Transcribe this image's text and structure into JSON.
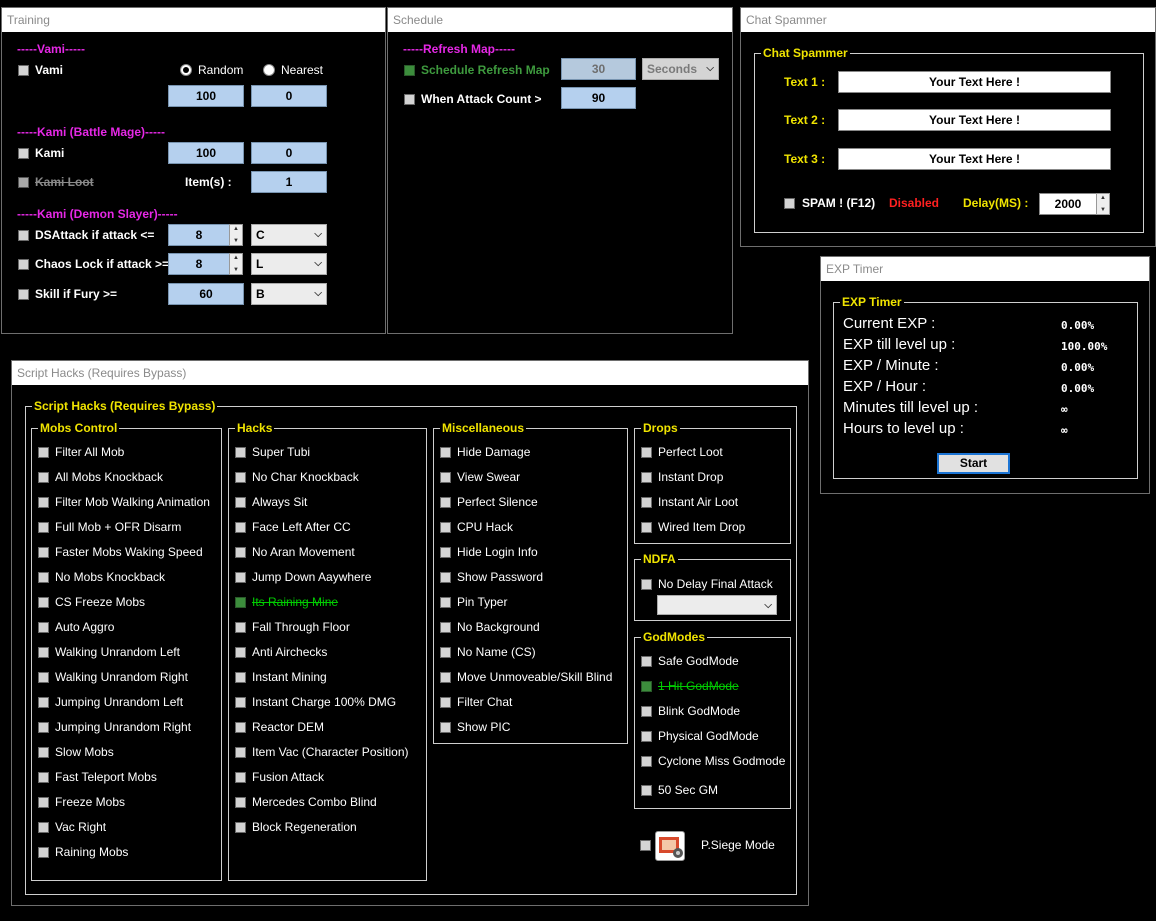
{
  "training": {
    "title": "Training",
    "vami_header": "-----Vami-----",
    "vami_label": "Vami",
    "radio_random": "Random",
    "radio_nearest": "Nearest",
    "vami_val1": "100",
    "vami_val2": "0",
    "kami_bm_header": "-----Kami (Battle Mage)-----",
    "kami_label": "Kami",
    "kami_val1": "100",
    "kami_val2": "0",
    "kami_loot_label": "Kami Loot",
    "items_label": "Item(s) :",
    "items_val": "1",
    "kami_ds_header": "-----Kami (Demon Slayer)-----",
    "ds_attack_label": "DSAttack if attack <=",
    "ds_attack_val": "8",
    "ds_attack_key": "C",
    "chaos_label": "Chaos Lock if attack >=",
    "chaos_val": "8",
    "chaos_key": "L",
    "skill_label": "Skill if Fury >=",
    "skill_val": "60",
    "skill_key": "B"
  },
  "schedule": {
    "title": "Schedule",
    "header": "-----Refresh Map-----",
    "refresh_label": "Schedule Refresh Map",
    "refresh_val": "30",
    "refresh_unit": "Seconds",
    "attack_label": "When Attack Count >",
    "attack_val": "90"
  },
  "chat": {
    "title": "Chat Spammer",
    "group_title": "Chat Spammer",
    "text1_label": "Text 1 :",
    "text1": "Your Text Here !",
    "text2_label": "Text 2 :",
    "text2": "Your Text Here !",
    "text3_label": "Text 3 :",
    "text3": "Your Text Here !",
    "spam_label": "SPAM ! (F12)",
    "status": "Disabled",
    "delay_label": "Delay(MS) :",
    "delay_val": "2000"
  },
  "exp": {
    "title": "EXP Timer",
    "group_title": "EXP Timer",
    "rows": [
      {
        "label": "Current EXP :",
        "value": "0.00%"
      },
      {
        "label": "EXP till level up :",
        "value": "100.00%"
      },
      {
        "label": "EXP / Minute :",
        "value": "0.00%"
      },
      {
        "label": "EXP / Hour :",
        "value": "0.00%"
      },
      {
        "label": "Minutes till level up :",
        "value": "∞"
      },
      {
        "label": "Hours to level up :",
        "value": "∞"
      }
    ],
    "start_button": "Start"
  },
  "script": {
    "title": "Script Hacks (Requires Bypass)",
    "group_title": "Script Hacks (Requires Bypass)",
    "mobs_title": "Mobs Control",
    "mobs": [
      "Filter All Mob",
      "All Mobs Knockback",
      "Filter Mob Walking Animation",
      "Full Mob + OFR Disarm",
      "Faster Mobs Waking Speed",
      "No Mobs Knockback",
      "CS Freeze Mobs",
      "Auto Aggro",
      "Walking Unrandom Left",
      "Walking Unrandom Right",
      "Jumping Unrandom Left",
      "Jumping Unrandom Right",
      "Slow Mobs",
      "Fast Teleport Mobs",
      "Freeze Mobs",
      "Vac Right",
      "Raining Mobs"
    ],
    "hacks_title": "Hacks",
    "hacks": [
      "Super Tubi",
      "No Char Knockback",
      "Always Sit",
      "Face Left After CC",
      "No Aran Movement",
      "Jump Down Aaywhere",
      "Its Raining Mine",
      "Fall Through Floor",
      "Anti Airchecks",
      "Instant Mining",
      "Instant Charge 100% DMG",
      "Reactor DEM",
      "Item Vac (Character Position)",
      "Fusion Attack",
      "Mercedes Combo Blind",
      "Block Regeneration"
    ],
    "misc_title": "Miscellaneous",
    "misc": [
      "Hide Damage",
      "View Swear",
      "Perfect Silence",
      "CPU Hack",
      "Hide Login Info",
      "Show Password",
      "Pin Typer",
      "No Background",
      "No Name (CS)",
      "Move Unmoveable/Skill Blind",
      "Filter Chat",
      "Show PIC"
    ],
    "drops_title": "Drops",
    "drops": [
      "Perfect Loot",
      "Instant Drop",
      "Instant Air Loot",
      "Wired Item Drop"
    ],
    "ndfa_title": "NDFA",
    "ndfa_label": "No Delay Final Attack",
    "god_title": "GodModes",
    "god": [
      "Safe GodMode",
      "1 Hit GodMode",
      "Blink GodMode",
      "Physical GodMode",
      "Cyclone Miss Godmode",
      "50 Sec GM"
    ],
    "siege_label": "P.Siege Mode"
  }
}
